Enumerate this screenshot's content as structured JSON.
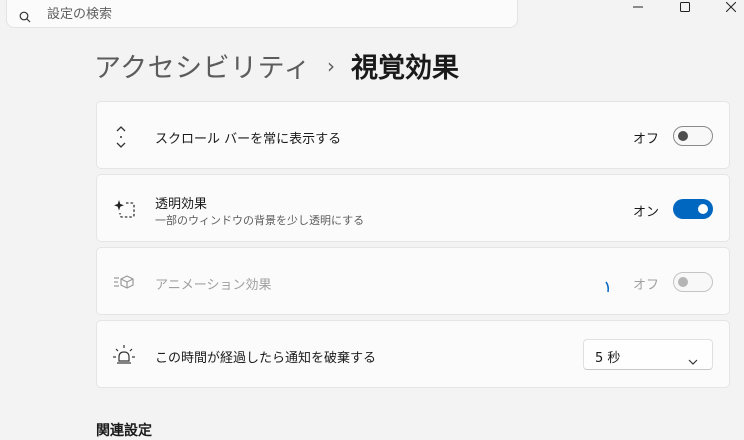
{
  "search": {
    "placeholder": "設定の検索"
  },
  "breadcrumb": {
    "parent": "アクセシビリティ",
    "separator": "›",
    "current": "視覚効果"
  },
  "settings": {
    "scrollbar": {
      "label": "スクロール バーを常に表示する",
      "state": "オフ",
      "enabled": false
    },
    "transparency": {
      "label": "透明効果",
      "description": "一部のウィンドウの背景を少し透明にする",
      "state": "オン",
      "enabled": true
    },
    "animation": {
      "label": "アニメーション効果",
      "state": "オフ",
      "enabled": false,
      "disabled": true
    },
    "notification": {
      "label": "この時間が経過したら通知を破棄する",
      "value": "5 秒"
    }
  },
  "related": {
    "title": "関連設定"
  },
  "colors": {
    "accent": "#0067c0",
    "background": "#f3f3f3",
    "card": "#fbfbfb"
  },
  "icons": [
    "search-icon",
    "minimize-icon",
    "maximize-icon",
    "close-icon",
    "scrollbar-icon",
    "transparency-icon",
    "animation-icon",
    "notification-icon",
    "chevron-down-icon"
  ]
}
